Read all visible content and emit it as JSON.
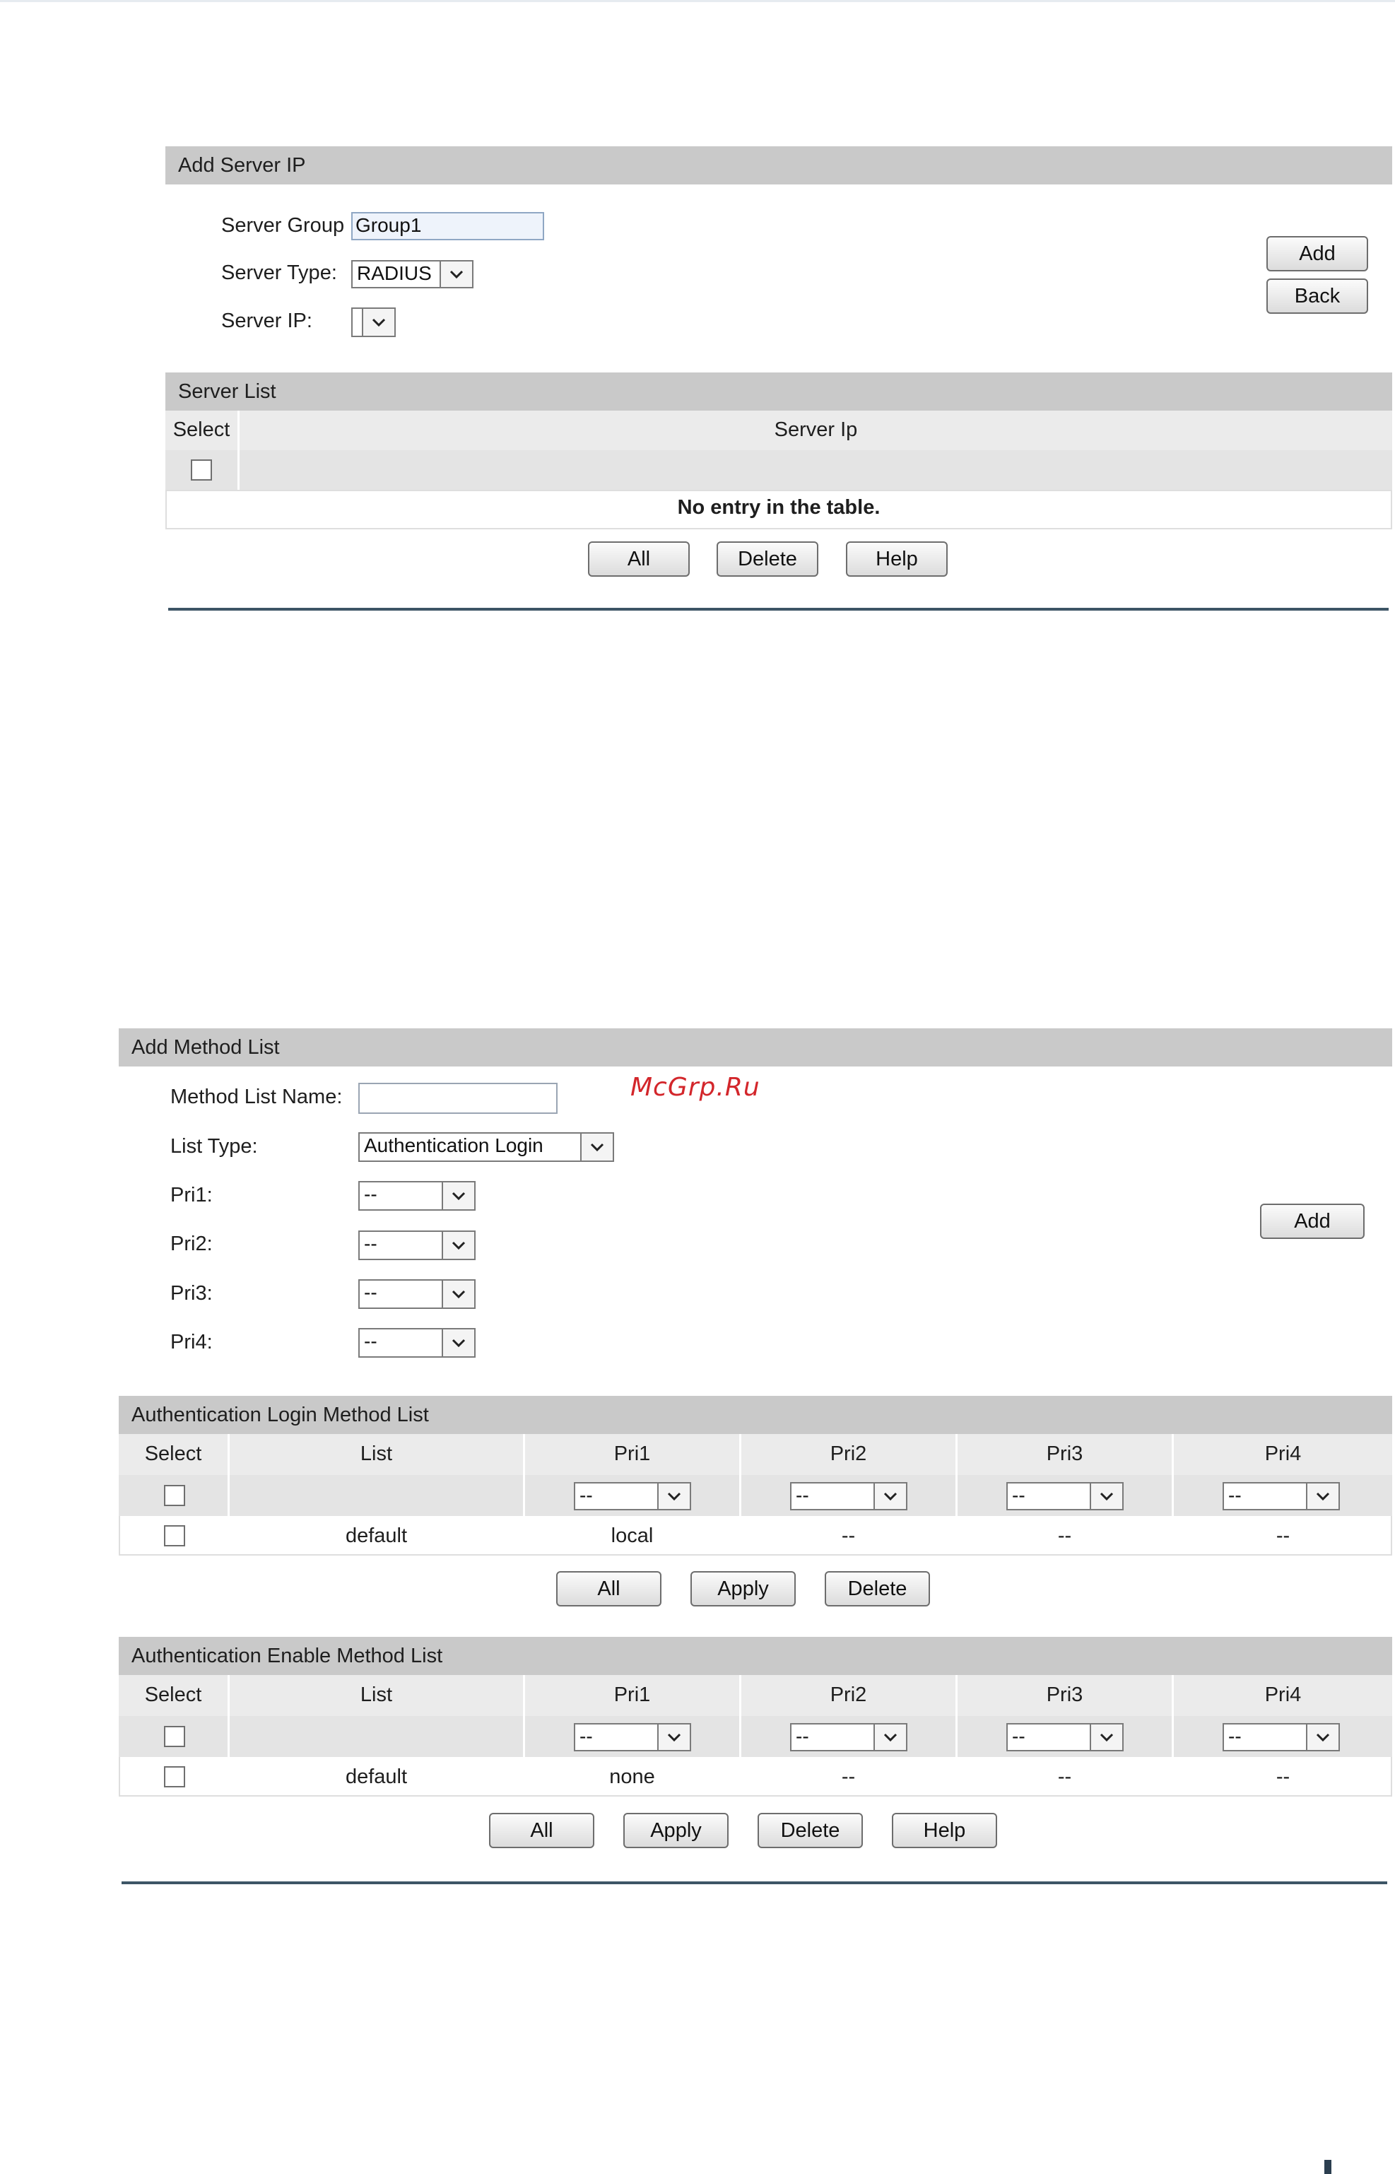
{
  "watermark": "McGrp.Ru",
  "add_server_ip": {
    "title": "Add Server IP",
    "server_group_label": "Server Group",
    "server_group_value": "Group1",
    "server_type_label": "Server Type:",
    "server_type_value": "RADIUS",
    "server_ip_label": "Server IP:",
    "server_ip_value": "",
    "add_button": "Add",
    "back_button": "Back"
  },
  "server_list": {
    "title": "Server List",
    "col_select": "Select",
    "col_server_ip": "Server Ip",
    "empty_message": "No entry in the table.",
    "buttons": {
      "all": "All",
      "delete": "Delete",
      "help": "Help"
    }
  },
  "add_method_list": {
    "title": "Add Method List",
    "name_label": "Method List Name:",
    "name_value": "",
    "list_type_label": "List Type:",
    "list_type_value": "Authentication Login",
    "pri1_label": "Pri1:",
    "pri1_value": "--",
    "pri2_label": "Pri2:",
    "pri2_value": "--",
    "pri3_label": "Pri3:",
    "pri3_value": "--",
    "pri4_label": "Pri4:",
    "pri4_value": "--",
    "add_button": "Add"
  },
  "auth_login_list": {
    "title": "Authentication Login Method List",
    "columns": [
      "Select",
      "List",
      "Pri1",
      "Pri2",
      "Pri3",
      "Pri4"
    ],
    "filter_values": [
      "--",
      "--",
      "--",
      "--"
    ],
    "rows": [
      {
        "list": "default",
        "pri1": "local",
        "pri2": "--",
        "pri3": "--",
        "pri4": "--"
      }
    ],
    "buttons": {
      "all": "All",
      "apply": "Apply",
      "delete": "Delete"
    }
  },
  "auth_enable_list": {
    "title": "Authentication Enable Method List",
    "columns": [
      "Select",
      "List",
      "Pri1",
      "Pri2",
      "Pri3",
      "Pri4"
    ],
    "filter_values": [
      "--",
      "--",
      "--",
      "--"
    ],
    "rows": [
      {
        "list": "default",
        "pri1": "none",
        "pri2": "--",
        "pri3": "--",
        "pri4": "--"
      }
    ],
    "buttons": {
      "all": "All",
      "apply": "Apply",
      "delete": "Delete",
      "help": "Help"
    }
  }
}
